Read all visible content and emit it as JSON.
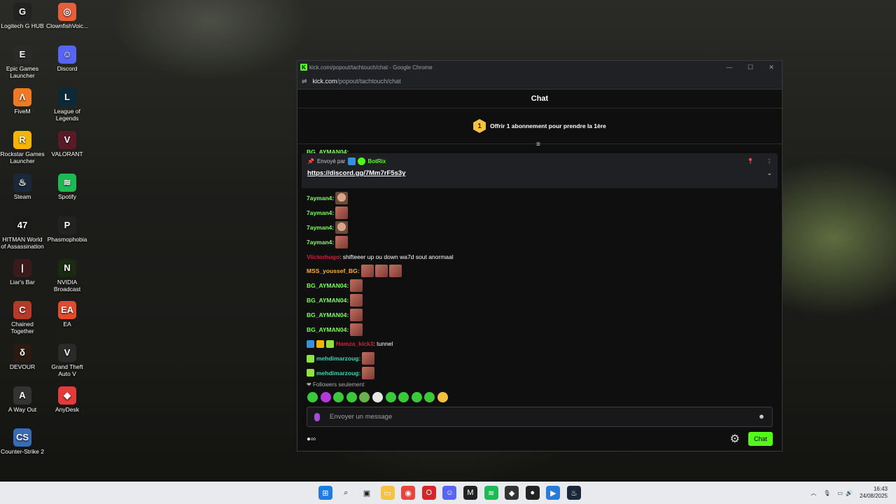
{
  "desktop_icons": [
    {
      "label": "Logitech G HUB",
      "color": "#222",
      "glyph": "G"
    },
    {
      "label": "ClownfishVoic...",
      "color": "#e85d3a",
      "glyph": "◎"
    },
    {
      "label": "Epic Games Launcher",
      "color": "#2a2a2a",
      "glyph": "E"
    },
    {
      "label": "Discord",
      "color": "#5865f2",
      "glyph": "☺"
    },
    {
      "label": "FiveM",
      "color": "#f07a24",
      "glyph": "Λ"
    },
    {
      "label": "League of Legends",
      "color": "#0a2a3a",
      "glyph": "L"
    },
    {
      "label": "Rockstar Games Launcher",
      "color": "#f5b400",
      "glyph": "R"
    },
    {
      "label": "VALORANT",
      "color": "#5a1b26",
      "glyph": "V"
    },
    {
      "label": "Steam",
      "color": "#1b2838",
      "glyph": "♨"
    },
    {
      "label": "Spotify",
      "color": "#1db954",
      "glyph": "≋"
    },
    {
      "label": "HITMAN World of Assassination",
      "color": "#1a1a1a",
      "glyph": "47"
    },
    {
      "label": "Phasmophobia",
      "color": "#222",
      "glyph": "P"
    },
    {
      "label": "Liar's Bar",
      "color": "#3a1a1a",
      "glyph": "|"
    },
    {
      "label": "NVIDIA Broadcast",
      "color": "#1a2a10",
      "glyph": "N"
    },
    {
      "label": "Chained Together",
      "color": "#b53a2a",
      "glyph": "C"
    },
    {
      "label": "EA",
      "color": "#e34a2a",
      "glyph": "EA"
    },
    {
      "label": "DEVOUR",
      "color": "#2a1a10",
      "glyph": "δ"
    },
    {
      "label": "Grand Theft Auto V",
      "color": "#2a2a2a",
      "glyph": "V"
    },
    {
      "label": "A Way Out",
      "color": "#333",
      "glyph": "A"
    },
    {
      "label": "AnyDesk",
      "color": "#e43a3a",
      "glyph": "◆"
    },
    {
      "label": "Counter-Strike 2",
      "color": "#3a6ab8",
      "glyph": "CS"
    }
  ],
  "window": {
    "title": "kick.com/popout/tachtouch/chat - Google Chrome",
    "url_host": "kick.com",
    "url_path": "/popout/tachtouch/chat",
    "logo": "K"
  },
  "chat": {
    "header": "Chat",
    "gift_number": "1",
    "gift_text": "Offrir 1 abonnement pour prendre la 1ère",
    "pinned": {
      "sent_by": "Envoyé par",
      "author": "BotRix",
      "link": "https://discord.gg/7Mm7rF5s3y"
    },
    "partial_top": "BG_AYMAN04:",
    "messages": [
      {
        "user": "7ayman4:",
        "color": "#7cff5a",
        "emotes": [
          "face"
        ],
        "text": ""
      },
      {
        "user": "7ayman4:",
        "color": "#7cff5a",
        "emotes": [
          "pic"
        ],
        "text": ""
      },
      {
        "user": "7ayman4:",
        "color": "#7cff5a",
        "emotes": [
          "face"
        ],
        "text": ""
      },
      {
        "user": "7ayman4:",
        "color": "#7cff5a",
        "emotes": [
          "pic"
        ],
        "text": ""
      },
      {
        "user": "Viictorhugo",
        "color": "#d81e3c",
        "emotes": [],
        "text": ": shifteeer up ou down wa7d sout anormaal"
      },
      {
        "user": "MSS_youssef_BG:",
        "color": "#f7b23c",
        "emotes": [
          "pic",
          "pic",
          "pic"
        ],
        "text": ""
      },
      {
        "user": "BG_AYMAN04:",
        "color": "#7cff5a",
        "emotes": [
          "pic"
        ],
        "text": ""
      },
      {
        "user": "BG_AYMAN04:",
        "color": "#7cff5a",
        "emotes": [
          "pic"
        ],
        "text": ""
      },
      {
        "user": "BG_AYMAN04:",
        "color": "#7cff5a",
        "emotes": [
          "pic"
        ],
        "text": ""
      },
      {
        "user": "BG_AYMAN04:",
        "color": "#7cff5a",
        "emotes": [
          "pic"
        ],
        "text": ""
      },
      {
        "user": "Hamza_kick3",
        "color": "#d81e3c",
        "emotes": [],
        "text": ": tunnel",
        "badges": [
          "#3a8fd8",
          "#f5b400",
          "#8fe33a"
        ]
      },
      {
        "user": "mehdimarzoug:",
        "color": "#36d6b0",
        "emotes": [
          "pic"
        ],
        "text": "",
        "badges": [
          "#8fe33a"
        ]
      },
      {
        "user": "mehdimarzoug:",
        "color": "#36d6b0",
        "emotes": [
          "pic"
        ],
        "text": "",
        "badges": [
          "#8fe33a"
        ]
      }
    ],
    "followers_only": "Followers seulement",
    "emote_bar": [
      "#3bc93b",
      "#b23ad8",
      "#3bc93b",
      "#3bc93b",
      "#6ab04c",
      "#e6e6e6",
      "#3bc93b",
      "#3bc93b",
      "#3bc93b",
      "#3bc93b",
      "#f0c040"
    ],
    "input_placeholder": "Envoyer un message",
    "send_label": "Chat"
  },
  "taskbar": {
    "apps": [
      {
        "name": "windows-start",
        "color": "#1e7be0",
        "glyph": "⊞"
      },
      {
        "name": "search",
        "color": "transparent",
        "glyph": "⌕"
      },
      {
        "name": "task-view",
        "color": "transparent",
        "glyph": "▣"
      },
      {
        "name": "file-explorer",
        "color": "#f5c242",
        "glyph": "▭"
      },
      {
        "name": "chrome",
        "color": "#e8453c",
        "glyph": "◉"
      },
      {
        "name": "opera",
        "color": "#d8242c",
        "glyph": "O"
      },
      {
        "name": "discord",
        "color": "#5865f2",
        "glyph": "☺"
      },
      {
        "name": "game-app",
        "color": "#222",
        "glyph": "M"
      },
      {
        "name": "spotify",
        "color": "#1db954",
        "glyph": "≋"
      },
      {
        "name": "kick-active",
        "color": "#333",
        "glyph": "◆"
      },
      {
        "name": "github",
        "color": "#222",
        "glyph": "●"
      },
      {
        "name": "media-player",
        "color": "#2a7bd8",
        "glyph": "▶"
      },
      {
        "name": "steam",
        "color": "#1b2838",
        "glyph": "♨"
      }
    ],
    "time": "16:43",
    "date": "24/08/2025"
  }
}
